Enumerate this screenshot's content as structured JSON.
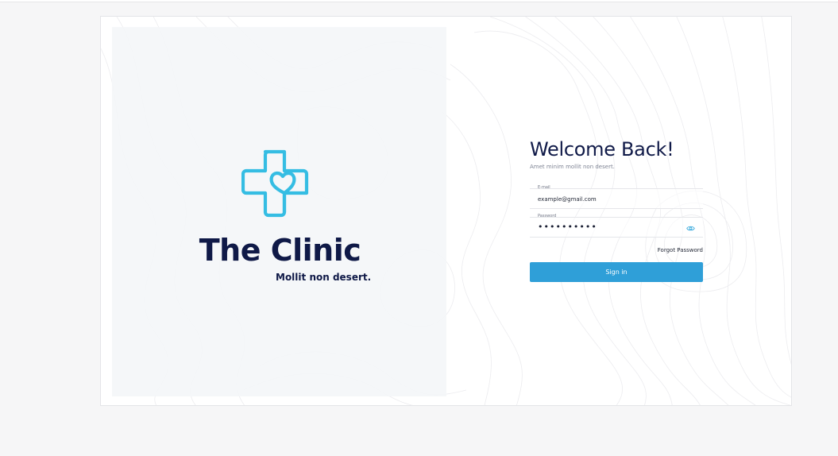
{
  "brand": {
    "name": "The Clinic",
    "tagline": "Mollit non desert.",
    "logo_icon": "medical-cross-heart-icon"
  },
  "login": {
    "title": "Welcome Back!",
    "subtitle": "Amet minim mollit non desert.",
    "email": {
      "label": "E-mail",
      "value": "example@gmail.com"
    },
    "password": {
      "label": "Password",
      "masked_value": "••••••••••",
      "toggle_icon": "eye-icon"
    },
    "forgot_label": "Forgot Password",
    "signin_label": "Sign in"
  },
  "colors": {
    "brand_navy": "#0f1947",
    "logo_cyan": "#35bde3",
    "button_blue": "#2f9fd8",
    "page_background": "#f6f6f7"
  }
}
